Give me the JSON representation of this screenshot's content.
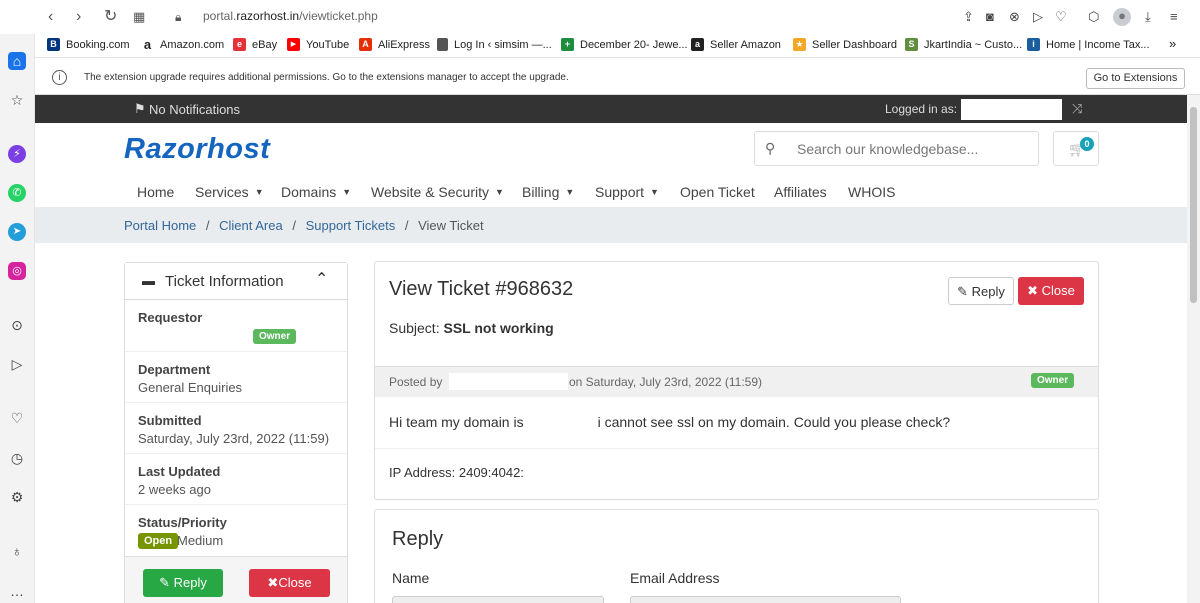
{
  "browser": {
    "url_prefix": "portal.",
    "url_host": "razorhost.in",
    "url_path": "/viewticket.php",
    "bookmarks": [
      {
        "label": "Booking.com",
        "icon": "booking-icon",
        "color": "#003580",
        "glyph": "B."
      },
      {
        "label": "Amazon.com",
        "icon": "amazon-icon",
        "color": "#222",
        "glyph": "a"
      },
      {
        "label": "eBay",
        "icon": "ebay-icon",
        "color": "#e53238",
        "glyph": "e"
      },
      {
        "label": "YouTube",
        "icon": "youtube-icon",
        "color": "#ff0000",
        "glyph": "▶"
      },
      {
        "label": "AliExpress",
        "icon": "aliexpress-icon",
        "color": "#e62e04",
        "glyph": "A"
      },
      {
        "label": "Log In ‹ simsim —...",
        "icon": "page-icon",
        "color": "#666",
        "glyph": ""
      },
      {
        "label": "December 20- Jewe...",
        "icon": "sheets-icon",
        "color": "#1e8e3e",
        "glyph": "+"
      },
      {
        "label": "Seller Amazon",
        "icon": "amazon-icon",
        "color": "#222",
        "glyph": "a"
      },
      {
        "label": "Seller Dashboard",
        "icon": "dashboard-icon",
        "color": "#f5a623",
        "glyph": "★"
      },
      {
        "label": "JkartIndia ~ Custo...",
        "icon": "shopify-icon",
        "color": "#5e8e3e",
        "glyph": "S"
      },
      {
        "label": "Home | Income Tax...",
        "icon": "income-tax-icon",
        "color": "#1a5e9e",
        "glyph": "i"
      }
    ],
    "more_bookmarks": "»",
    "infobar_text": "The extension upgrade requires additional permissions. Go to the extensions manager to accept the upgrade.",
    "infobar_button": "Go to Extensions"
  },
  "page": {
    "notifications": "No Notifications",
    "logged_in_label": "Logged in as:",
    "logo": "Razorhost",
    "search_placeholder": "Search our knowledgebase...",
    "cart_count": "0",
    "menu": [
      {
        "label": "Home",
        "dropdown": false
      },
      {
        "label": "Services",
        "dropdown": true
      },
      {
        "label": "Domains",
        "dropdown": true
      },
      {
        "label": "Website & Security",
        "dropdown": true
      },
      {
        "label": "Billing",
        "dropdown": true
      },
      {
        "label": "Support",
        "dropdown": true
      },
      {
        "label": "Open Ticket",
        "dropdown": false
      },
      {
        "label": "Affiliates",
        "dropdown": false
      },
      {
        "label": "WHOIS",
        "dropdown": false
      }
    ],
    "breadcrumb": [
      "Portal Home",
      "Client Area",
      "Support Tickets",
      "View Ticket"
    ],
    "breadcrumb_sep": "/"
  },
  "ticket_info": {
    "title": "Ticket Information",
    "requestor_label": "Requestor",
    "owner_badge": "Owner",
    "department_label": "Department",
    "department_value": "General Enquiries",
    "submitted_label": "Submitted",
    "submitted_value": "Saturday, July 23rd, 2022 (11:59)",
    "updated_label": "Last Updated",
    "updated_value": "2 weeks ago",
    "status_label": "Status/Priority",
    "status_badge": "Open",
    "priority_value": "Medium",
    "reply_button": "Reply",
    "close_button": "Close"
  },
  "ticket": {
    "title": "View Ticket #968632",
    "reply_button": "Reply",
    "close_button": "Close",
    "subject_label": "Subject:",
    "subject_value": "SSL not working",
    "posted_by": "Posted by",
    "posted_on": "on Saturday, July 23rd, 2022 (11:59)",
    "owner_badge": "Owner",
    "message_start": "Hi team my domain is",
    "message_end": "i cannot see ssl on my domain. Could you please check?",
    "ip_address": "IP Address: 2409:4042:"
  },
  "reply_form": {
    "title": "Reply",
    "name_label": "Name",
    "email_label": "Email Address"
  },
  "colors": {
    "topbar": "#333333",
    "logo_blue": "#1565c0",
    "owner_green": "#5cb85c",
    "open_green": "#779500",
    "close_red": "#dc3545",
    "reply_green": "#28a745"
  }
}
